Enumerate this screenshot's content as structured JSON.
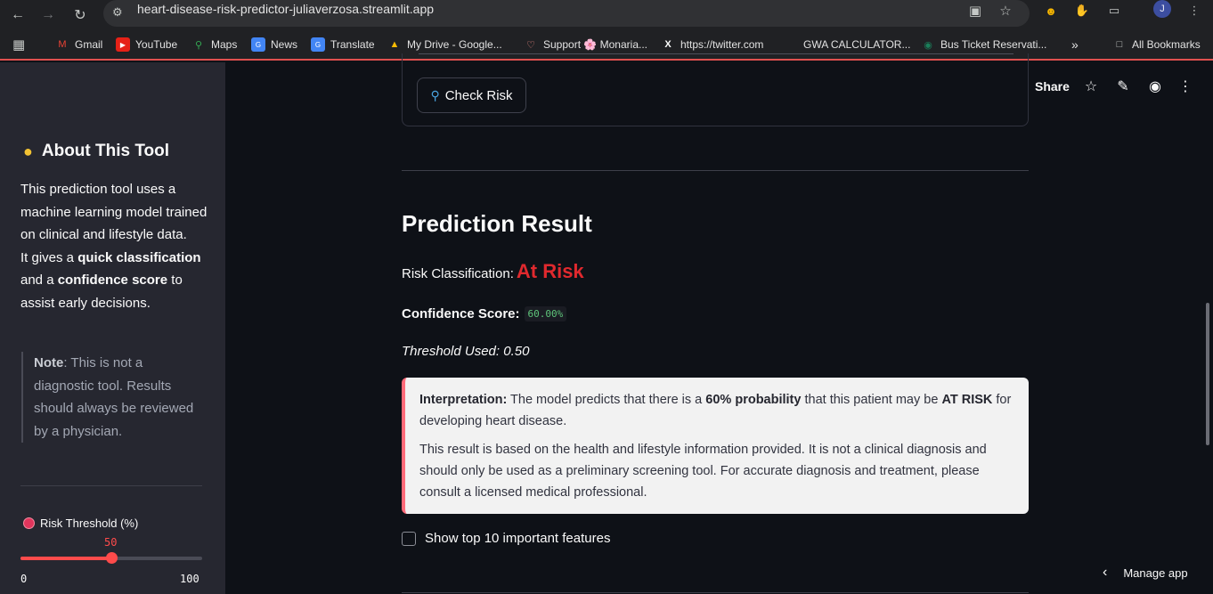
{
  "browser": {
    "url": "heart-disease-risk-predictor-juliaverzosa.streamlit.app",
    "profile_initial": "J"
  },
  "bookmarks": [
    {
      "label": "Gmail",
      "icon": "gmail-icon"
    },
    {
      "label": "YouTube",
      "icon": "youtube-icon"
    },
    {
      "label": "Maps",
      "icon": "maps-icon"
    },
    {
      "label": "News",
      "icon": "news-icon"
    },
    {
      "label": "Translate",
      "icon": "translate-icon"
    },
    {
      "label": "My Drive - Google...",
      "icon": "drive-icon"
    },
    {
      "label": "Support 🌸 Monaria...",
      "icon": "support-icon"
    },
    {
      "label": "https://twitter.com",
      "icon": "x-icon"
    },
    {
      "label": "GWA CALCULATOR...",
      "icon": "blank-icon"
    },
    {
      "label": "Bus Ticket Reservati...",
      "icon": "bus-icon"
    }
  ],
  "bookmarks_overflow": "»",
  "all_bookmarks": "All Bookmarks",
  "sidebar": {
    "title": "About This Tool",
    "para_1": "This prediction tool uses a machine learning model trained on clinical and lifestyle data.",
    "para_2_prefix": "It gives a ",
    "para_2_bold_1": "quick classification",
    "para_2_mid": " and a ",
    "para_2_bold_2": "confidence score",
    "para_2_suffix": " to assist early decisions.",
    "note_label": "Note",
    "note_text": ": This is not a diagnostic tool. Results should always be reviewed by a physician.",
    "threshold_label": "Risk Threshold (%)",
    "threshold_value": 50,
    "threshold_min": "0",
    "threshold_max": "100"
  },
  "toolbar": {
    "share": "Share"
  },
  "main": {
    "check_button": "Check Risk",
    "result_title": "Prediction Result",
    "risk_label": "Risk Classification:",
    "risk_value": "At Risk",
    "confidence_label": "Confidence Score:",
    "confidence_value": "60.00%",
    "threshold_used": "Threshold Used: 0.50",
    "interp_label": "Interpretation:",
    "interp_text_1": " The model predicts that there is a ",
    "interp_bold_1": "60% probability",
    "interp_text_2": " that this patient may be ",
    "interp_bold_2": "AT RISK",
    "interp_text_3": " for developing heart disease.",
    "interp_para_2": "This result is based on the health and lifestyle information provided. It is not a clinical diagnosis and should only be used as a preliminary screening tool. For accurate diagnosis and treatment, please consult a licensed medical professional.",
    "show_features": "Show top 10 important features",
    "show_features_checked": false
  },
  "manage_app": "Manage app",
  "colors": {
    "accent": "#ff4b4b",
    "risk": "#e0292e",
    "background": "#0e1117",
    "sidebar": "#262730"
  }
}
